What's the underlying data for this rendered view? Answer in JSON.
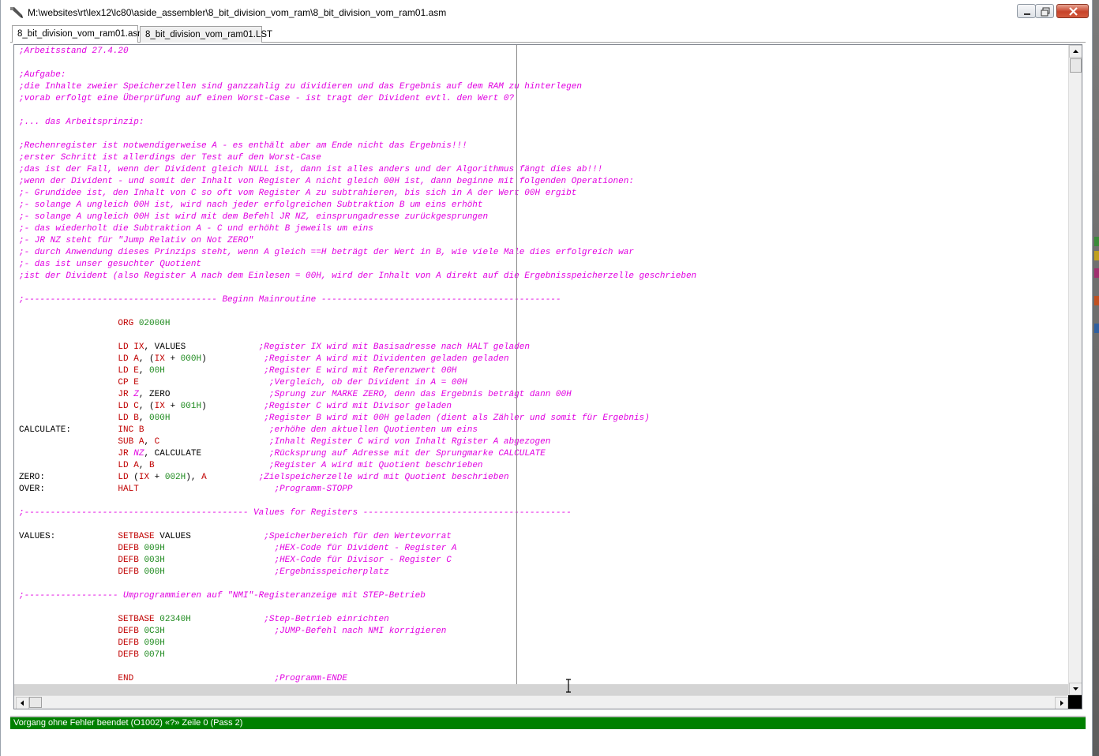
{
  "window": {
    "title": "M:\\websites\\rt\\lex12\\lc80\\aside_assembler\\8_bit_division_vom_ram\\8_bit_division_vom_ram01.asm"
  },
  "tabs": [
    {
      "label": "8_bit_division_vom_ram01.asm",
      "active": true
    },
    {
      "label": "8_bit_division_vom_ram01.LST",
      "active": false
    }
  ],
  "colors": {
    "comment": "#e100e1",
    "keyword": "#c00000",
    "number": "#1e8a1e",
    "status_bar": "#008000"
  },
  "code_lines": [
    [
      {
        "t": ";Arbeitsstand 27.4.20",
        "c": "cmt"
      }
    ],
    [],
    [
      {
        "t": ";Aufgabe:",
        "c": "cmt"
      }
    ],
    [
      {
        "t": ";die Inhalte zweier Speicherzellen sind ganzzahlig zu dividieren und das Ergebnis auf dem RAM zu hinterlegen",
        "c": "cmt"
      }
    ],
    [
      {
        "t": ";vorab erfolgt eine Überprüfung auf einen Worst-Case - ist tragt der Divident evtl. den Wert 0?",
        "c": "cmt"
      }
    ],
    [],
    [
      {
        "t": ";... das Arbeitsprinzip:",
        "c": "cmt"
      }
    ],
    [],
    [
      {
        "t": ";Rechenregister ist notwendigerweise A - es enthält aber am Ende nicht das Ergebnis!!!",
        "c": "cmt"
      }
    ],
    [
      {
        "t": ";erster Schritt ist allerdings der Test auf den Worst-Case",
        "c": "cmt"
      }
    ],
    [
      {
        "t": ";das ist der Fall, wenn der Divident gleich NULL ist, dann ist alles anders und der Algorithmus fängt dies ab!!!",
        "c": "cmt"
      }
    ],
    [
      {
        "t": ";wenn der Divident - und somit der Inhalt von Register A nicht gleich 00H ist, dann beginne mit folgenden Operationen:",
        "c": "cmt"
      }
    ],
    [
      {
        "t": ";- Grundidee ist, den Inhalt von C so oft vom Register A zu subtrahieren, bis sich in A der Wert 00H ergibt",
        "c": "cmt"
      }
    ],
    [
      {
        "t": ";- solange A ungleich 00H ist, wird nach jeder erfolgreichen Subtraktion B um eins erhöht",
        "c": "cmt"
      }
    ],
    [
      {
        "t": ";- solange A ungleich 00H ist wird mit dem Befehl JR NZ, einsprungadresse zurückgesprungen",
        "c": "cmt"
      }
    ],
    [
      {
        "t": ";- das wiederholt die Subtraktion A - C und erhöht B jeweils um eins",
        "c": "cmt"
      }
    ],
    [
      {
        "t": ";- JR NZ steht für \"Jump Relativ on Not ZERO\"",
        "c": "cmt"
      }
    ],
    [
      {
        "t": ";- durch Anwendung dieses Prinzips steht, wenn A gleich ==H beträgt der Wert in B, wie viele Male dies erfolgreich war",
        "c": "cmt"
      }
    ],
    [
      {
        "t": ";- das ist unser gesuchter Quotient",
        "c": "cmt"
      }
    ],
    [
      {
        "t": ";ist der Divident (also Register A nach dem Einlesen = 00H, wird der Inhalt von A direkt auf die Ergebnisspeicherzelle geschrieben",
        "c": "cmt"
      }
    ],
    [],
    [
      {
        "t": ";------------------------------------- Beginn Mainroutine ----------------------------------------------",
        "c": "cmt"
      }
    ],
    [],
    [
      {
        "t": "                   "
      },
      {
        "t": "ORG ",
        "c": "kw"
      },
      {
        "t": "02000H",
        "c": "num"
      }
    ],
    [],
    [
      {
        "t": "                   "
      },
      {
        "t": "LD ",
        "c": "kw"
      },
      {
        "t": "IX",
        "c": "reg"
      },
      {
        "t": ", VALUES              ",
        "c": "plain"
      },
      {
        "t": ";Register IX wird mit Basisadresse nach HALT geladen",
        "c": "cmt"
      }
    ],
    [
      {
        "t": "                   "
      },
      {
        "t": "LD ",
        "c": "kw"
      },
      {
        "t": "A",
        "c": "reg"
      },
      {
        "t": ", (",
        "c": "plain"
      },
      {
        "t": "IX",
        "c": "reg"
      },
      {
        "t": " + ",
        "c": "plain"
      },
      {
        "t": "000H",
        "c": "num"
      },
      {
        "t": ")           ",
        "c": "plain"
      },
      {
        "t": ";Register A wird mit Dividenten geladen geladen",
        "c": "cmt"
      }
    ],
    [
      {
        "t": "                   "
      },
      {
        "t": "LD ",
        "c": "kw"
      },
      {
        "t": "E",
        "c": "reg"
      },
      {
        "t": ", ",
        "c": "plain"
      },
      {
        "t": "00H",
        "c": "num"
      },
      {
        "t": "                   ",
        "c": "plain"
      },
      {
        "t": ";Register E wird mit Referenzwert 00H",
        "c": "cmt"
      }
    ],
    [
      {
        "t": "                   "
      },
      {
        "t": "CP ",
        "c": "kw"
      },
      {
        "t": "E",
        "c": "reg"
      },
      {
        "t": "                         ",
        "c": "plain"
      },
      {
        "t": ";Vergleich, ob der Divident in A = 00H",
        "c": "cmt"
      }
    ],
    [
      {
        "t": "                   "
      },
      {
        "t": "JR ",
        "c": "kw"
      },
      {
        "t": "Z",
        "c": "cmt"
      },
      {
        "t": ", ZERO                   ",
        "c": "plain"
      },
      {
        "t": ";Sprung zur MARKE ZERO, denn das Ergebnis beträgt dann 00H",
        "c": "cmt"
      }
    ],
    [
      {
        "t": "                   "
      },
      {
        "t": "LD ",
        "c": "kw"
      },
      {
        "t": "C",
        "c": "reg"
      },
      {
        "t": ", (",
        "c": "plain"
      },
      {
        "t": "IX",
        "c": "reg"
      },
      {
        "t": " + ",
        "c": "plain"
      },
      {
        "t": "001H",
        "c": "num"
      },
      {
        "t": ")           ",
        "c": "plain"
      },
      {
        "t": ";Register C wird mit Divisor geladen",
        "c": "cmt"
      }
    ],
    [
      {
        "t": "                   "
      },
      {
        "t": "LD ",
        "c": "kw"
      },
      {
        "t": "B",
        "c": "reg"
      },
      {
        "t": ", ",
        "c": "plain"
      },
      {
        "t": "000H",
        "c": "num"
      },
      {
        "t": "                  ",
        "c": "plain"
      },
      {
        "t": ";Register B wird mit 00H geladen (dient als Zähler und somit für Ergebnis)",
        "c": "cmt"
      }
    ],
    [
      {
        "t": "CALCULATE:         ",
        "c": "lbl"
      },
      {
        "t": "INC ",
        "c": "kw"
      },
      {
        "t": "B",
        "c": "reg"
      },
      {
        "t": "                        ",
        "c": "plain"
      },
      {
        "t": ";erhöhe den aktuellen Quotienten um eins",
        "c": "cmt"
      }
    ],
    [
      {
        "t": "                   "
      },
      {
        "t": "SUB ",
        "c": "kw"
      },
      {
        "t": "A",
        "c": "reg"
      },
      {
        "t": ", ",
        "c": "plain"
      },
      {
        "t": "C",
        "c": "reg"
      },
      {
        "t": "                     ",
        "c": "plain"
      },
      {
        "t": ";Inhalt Register C wird von Inhalt Rgister A abgezogen",
        "c": "cmt"
      }
    ],
    [
      {
        "t": "                   "
      },
      {
        "t": "JR ",
        "c": "kw"
      },
      {
        "t": "NZ",
        "c": "cmt"
      },
      {
        "t": ", CALCULATE             ",
        "c": "plain"
      },
      {
        "t": ";Rücksprung auf Adresse mit der Sprungmarke CALCULATE",
        "c": "cmt"
      }
    ],
    [
      {
        "t": "                   "
      },
      {
        "t": "LD ",
        "c": "kw"
      },
      {
        "t": "A",
        "c": "reg"
      },
      {
        "t": ", ",
        "c": "plain"
      },
      {
        "t": "B",
        "c": "reg"
      },
      {
        "t": "                      ",
        "c": "plain"
      },
      {
        "t": ";Register A wird mit Quotient beschrieben",
        "c": "cmt"
      }
    ],
    [
      {
        "t": "ZERO:              ",
        "c": "lbl"
      },
      {
        "t": "LD ",
        "c": "kw"
      },
      {
        "t": "(",
        "c": "plain"
      },
      {
        "t": "IX",
        "c": "reg"
      },
      {
        "t": " + ",
        "c": "plain"
      },
      {
        "t": "002H",
        "c": "num"
      },
      {
        "t": "), ",
        "c": "plain"
      },
      {
        "t": "A",
        "c": "reg"
      },
      {
        "t": "          ",
        "c": "plain"
      },
      {
        "t": ";Zielspeicherzelle wird mit Quotient beschrieben",
        "c": "cmt"
      }
    ],
    [
      {
        "t": "OVER:              ",
        "c": "lbl"
      },
      {
        "t": "HALT",
        "c": "kw"
      },
      {
        "t": "                          ",
        "c": "plain"
      },
      {
        "t": ";Programm-STOPP",
        "c": "cmt"
      }
    ],
    [],
    [
      {
        "t": ";------------------------------------------- Values for Registers ----------------------------------------",
        "c": "cmt"
      }
    ],
    [],
    [
      {
        "t": "VALUES:            ",
        "c": "lbl"
      },
      {
        "t": "SETBASE ",
        "c": "kw"
      },
      {
        "t": "VALUES",
        "c": "plain"
      },
      {
        "t": "              ",
        "c": "plain"
      },
      {
        "t": ";Speicherbereich für den Wertevorrat",
        "c": "cmt"
      }
    ],
    [
      {
        "t": "                   "
      },
      {
        "t": "DEFB ",
        "c": "kw"
      },
      {
        "t": "009H",
        "c": "num"
      },
      {
        "t": "                     ",
        "c": "plain"
      },
      {
        "t": ";HEX-Code für Divident - Register A",
        "c": "cmt"
      }
    ],
    [
      {
        "t": "                   "
      },
      {
        "t": "DEFB ",
        "c": "kw"
      },
      {
        "t": "003H",
        "c": "num"
      },
      {
        "t": "                     ",
        "c": "plain"
      },
      {
        "t": ";HEX-Code für Divisor - Register C",
        "c": "cmt"
      }
    ],
    [
      {
        "t": "                   "
      },
      {
        "t": "DEFB ",
        "c": "kw"
      },
      {
        "t": "000H",
        "c": "num"
      },
      {
        "t": "                     ",
        "c": "plain"
      },
      {
        "t": ";Ergebnisspeicherplatz",
        "c": "cmt"
      }
    ],
    [],
    [
      {
        "t": ";------------------ Umprogrammieren auf \"NMI\"-Registeranzeige mit STEP-Betrieb",
        "c": "cmt"
      }
    ],
    [],
    [
      {
        "t": "                   "
      },
      {
        "t": "SETBASE ",
        "c": "kw"
      },
      {
        "t": "02340H",
        "c": "num"
      },
      {
        "t": "              ",
        "c": "plain"
      },
      {
        "t": ";Step-Betrieb einrichten",
        "c": "cmt"
      }
    ],
    [
      {
        "t": "                   "
      },
      {
        "t": "DEFB ",
        "c": "kw"
      },
      {
        "t": "0C3H",
        "c": "num"
      },
      {
        "t": "                     ",
        "c": "plain"
      },
      {
        "t": ";JUMP-Befehl nach NMI korrigieren",
        "c": "cmt"
      }
    ],
    [
      {
        "t": "                   "
      },
      {
        "t": "DEFB ",
        "c": "kw"
      },
      {
        "t": "090H",
        "c": "num"
      }
    ],
    [
      {
        "t": "                   "
      },
      {
        "t": "DEFB ",
        "c": "kw"
      },
      {
        "t": "007H",
        "c": "num"
      }
    ],
    [],
    [
      {
        "t": "                   "
      },
      {
        "t": "END",
        "c": "kw"
      },
      {
        "t": "                           ",
        "c": "plain"
      },
      {
        "t": ";Programm-ENDE",
        "c": "cmt"
      }
    ]
  ],
  "status": {
    "message": "Vorgang ohne Fehler beendet (O1002) «?» Zeile 0 (Pass 2)"
  },
  "icons": {
    "app": "pencil-app-icon",
    "minimize": "minimize-icon",
    "maximize": "maximize-icon",
    "close": "close-icon",
    "cursor": "text-cursor-icon"
  }
}
